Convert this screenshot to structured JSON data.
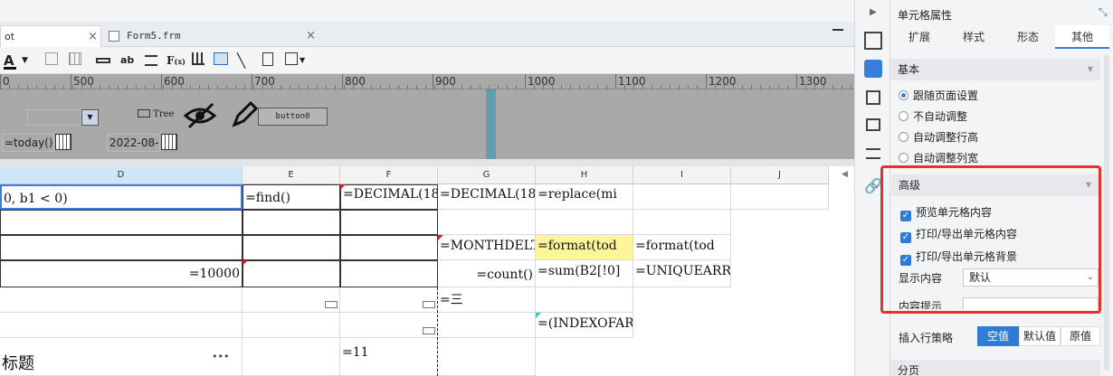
{
  "tabs": [
    {
      "label": "ot",
      "close": "×"
    },
    {
      "label": "Form5.frm",
      "close": "×"
    }
  ],
  "ruler": {
    "labels": [
      "0",
      "500",
      "600",
      "700",
      "800",
      "900",
      "1000",
      "1100",
      "1200",
      "1300"
    ]
  },
  "param_widgets": {
    "tree_label": "Tree",
    "button_label": "button0",
    "date_formula": "=today()",
    "date_value": "2022-08-"
  },
  "grid": {
    "columns": [
      "D",
      "E",
      "F",
      "G",
      "H",
      "I",
      "J"
    ],
    "cells": {
      "d1": "0, b1 < 0)",
      "e1": "=find()",
      "f1": "=DECIMAL(18",
      "g1": "=DECIMAL(18",
      "h1": "=replace(mi",
      "g3": "=MONTHDELTA",
      "h3": "=format(tod",
      "i3": "=format(tod",
      "d4": "=10000",
      "g4": "=count()",
      "h4": "=sum(B2[!0]",
      "i4": "=UNIQUEARRA",
      "g5": "=三",
      "h6": "=(INDEXOFAR",
      "d7": "标题",
      "d7_more": "•••",
      "f7": "=11"
    }
  },
  "panel": {
    "title": "单元格属性",
    "tabs": [
      "扩展",
      "样式",
      "形态",
      "其他"
    ],
    "active_tab": "其他",
    "basic": {
      "header": "基本",
      "options": [
        "跟随页面设置",
        "不自动调整",
        "自动调整行高",
        "自动调整列宽"
      ],
      "selected": "跟随页面设置"
    },
    "advanced": {
      "header": "高级",
      "checks": [
        "预览单元格内容",
        "打印/导出单元格内容",
        "打印/导出单元格背景"
      ],
      "display_label": "显示内容",
      "display_value": "默认",
      "tooltip_label": "内容提示"
    },
    "insert": {
      "label": "插入行策略",
      "options": [
        "空值",
        "默认值",
        "原值"
      ],
      "selected": "空值"
    },
    "paging": {
      "header": "分页"
    }
  },
  "colors": {
    "accent": "#2f7bd8",
    "highlight_box": "#e8312a",
    "yellow_cell": "#fdf59a",
    "ruler_bg": "#a9a9a9"
  }
}
